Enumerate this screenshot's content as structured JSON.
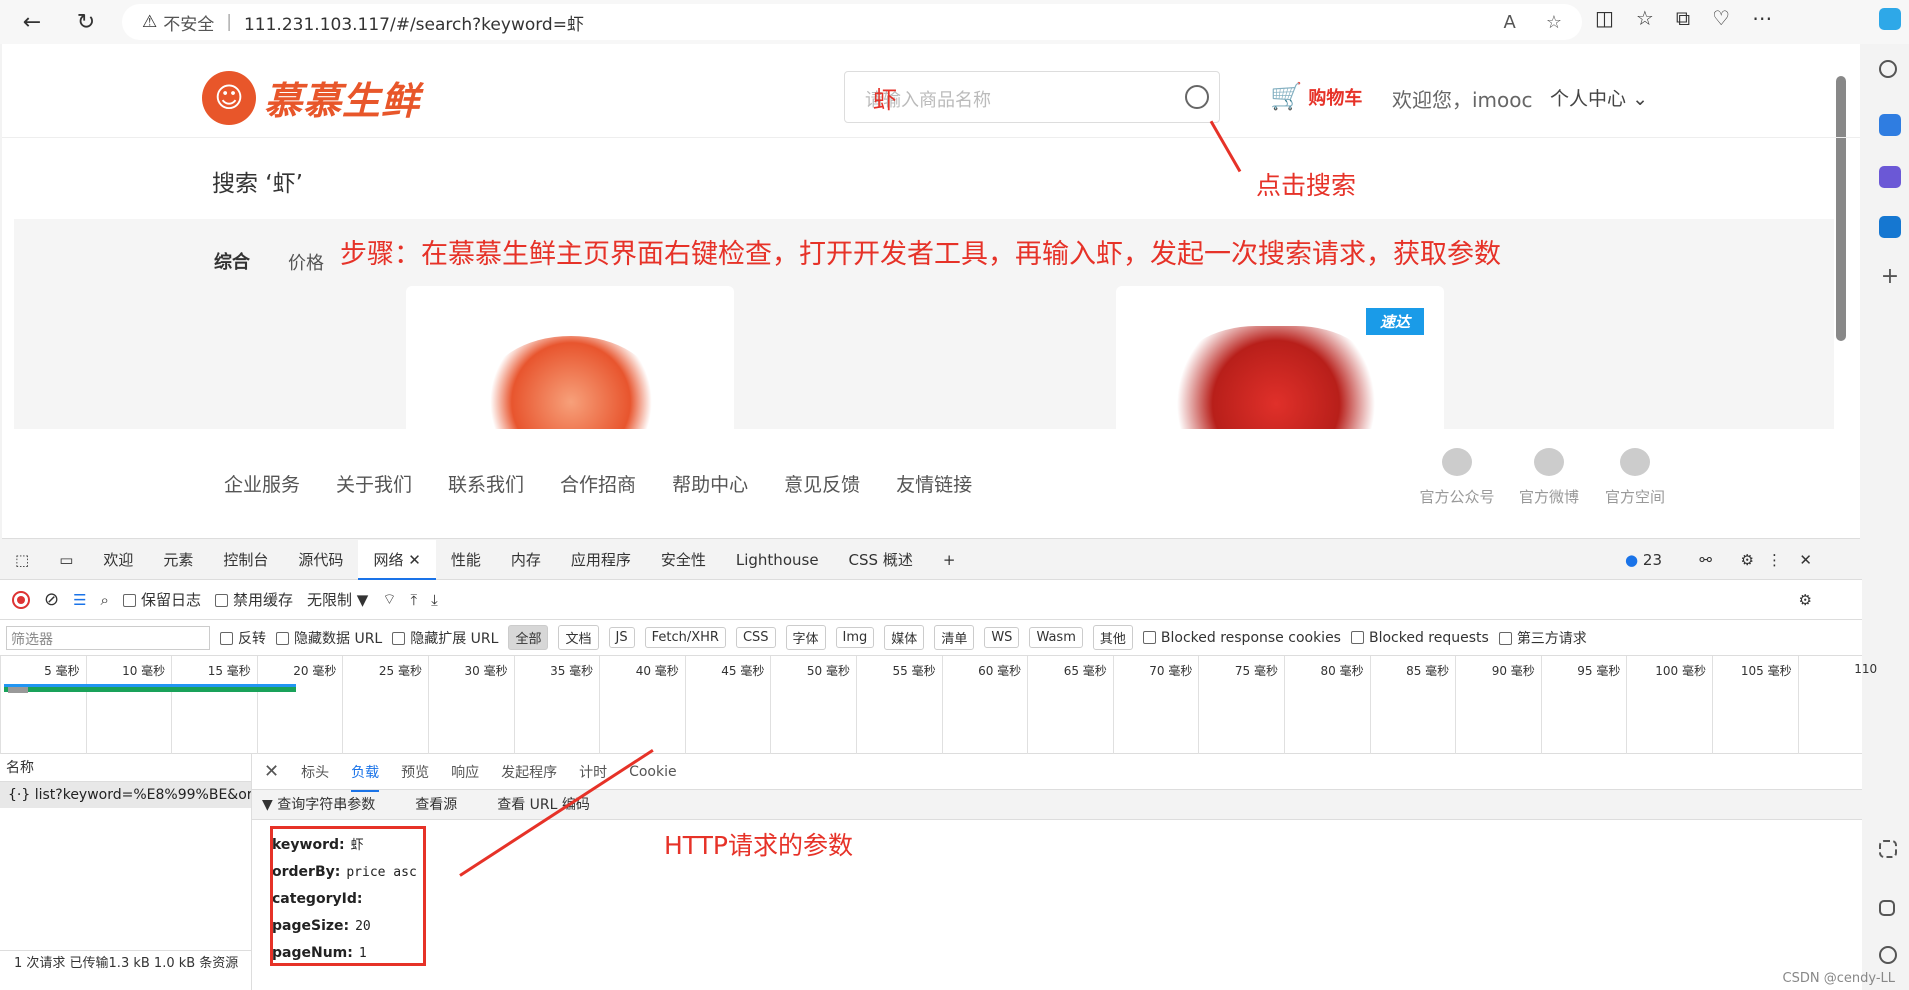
{
  "browser": {
    "insecure_label": "不安全",
    "url": "111.231.103.117/#/search?keyword=虾"
  },
  "site": {
    "logo_text": "慕慕生鲜",
    "search_placeholder": "请输入商品名称",
    "search_typed": "虾",
    "cart_label": "购物车",
    "welcome": "欢迎您，imooc",
    "user_center": "个人中心",
    "search_title": "搜索  ‘虾’",
    "filters": {
      "all": "综合",
      "price": "价格"
    },
    "card2_badge": "速达",
    "footer_links": [
      "企业服务",
      "关于我们",
      "联系我们",
      "合作招商",
      "帮助中心",
      "意见反馈",
      "友情链接"
    ],
    "social": [
      "官方公众号",
      "官方微博",
      "官方空间"
    ]
  },
  "annotations": {
    "click_search": "点击搜索",
    "step": "步骤：在慕慕生鲜主页界面右键检查，打开开发者工具，再输入虾，发起一次搜索请求，获取参数",
    "http_params": "HTTP请求的参数"
  },
  "devtools": {
    "tabs": [
      "欢迎",
      "元素",
      "控制台",
      "源代码",
      "网络",
      "性能",
      "内存",
      "应用程序",
      "安全性",
      "Lighthouse",
      "CSS 概述"
    ],
    "active_tab": "网络",
    "issues_count": "23",
    "toolbar": {
      "preserve_log": "保留日志",
      "disable_cache": "禁用缓存",
      "throttle": "无限制"
    },
    "filter": {
      "placeholder": "筛选器",
      "invert": "反转",
      "hide_data_url": "隐藏数据 URL",
      "hide_ext_url": "隐藏扩展 URL",
      "types": [
        "全部",
        "文档",
        "JS",
        "Fetch/XHR",
        "CSS",
        "字体",
        "Img",
        "媒体",
        "清单",
        "WS",
        "Wasm",
        "其他"
      ],
      "blocked_cookies": "Blocked response cookies",
      "blocked_requests": "Blocked requests",
      "third_party": "第三方请求"
    },
    "timeline_ticks": [
      "5 毫秒",
      "10 毫秒",
      "15 毫秒",
      "20 毫秒",
      "25 毫秒",
      "30 毫秒",
      "35 毫秒",
      "40 毫秒",
      "45 毫秒",
      "50 毫秒",
      "55 毫秒",
      "60 毫秒",
      "65 毫秒",
      "70 毫秒",
      "75 毫秒",
      "80 毫秒",
      "85 毫秒",
      "90 毫秒",
      "95 毫秒",
      "100 毫秒",
      "105 毫秒",
      "110"
    ],
    "name_header": "名称",
    "request_row": "list?keyword=%E8%99%BE&or...",
    "status": "1 次请求  已传输1.3 kB  1.0 kB 条资源",
    "detail_tabs": [
      "标头",
      "负载",
      "预览",
      "响应",
      "发起程序",
      "计时",
      "Cookie"
    ],
    "active_detail_tab": "负载",
    "qs_header": "查询字符串参数",
    "view_source": "查看源",
    "view_url_encoded": "查看 URL 编码",
    "params": [
      {
        "key": "keyword:",
        "value": "虾"
      },
      {
        "key": "orderBy:",
        "value": "price asc"
      },
      {
        "key": "categoryId:",
        "value": ""
      },
      {
        "key": "pageSize:",
        "value": "20"
      },
      {
        "key": "pageNum:",
        "value": "1"
      }
    ]
  },
  "watermark": "CSDN @cendy-LL"
}
